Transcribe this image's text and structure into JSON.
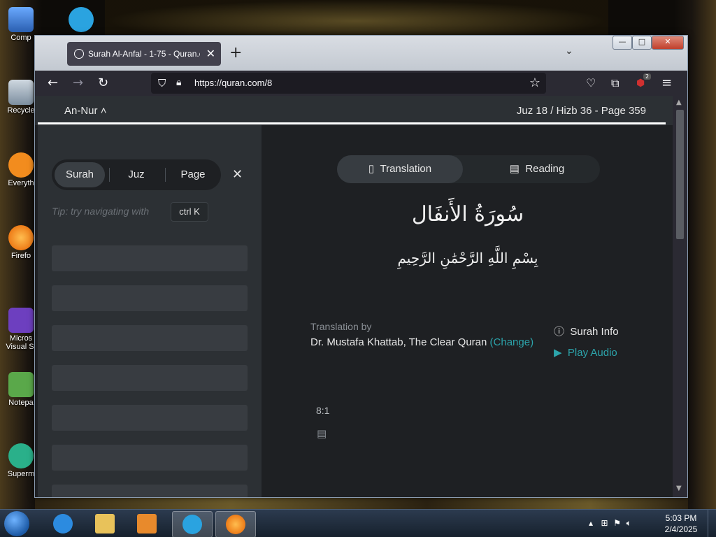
{
  "desktop": {
    "icons": [
      {
        "label": "Comp",
        "color": "#3a7bd5"
      },
      {
        "label": "Recycle",
        "color": "#8fa8c0"
      },
      {
        "label": "Everyth",
        "color": "#f28c1e"
      },
      {
        "label": "Firefo",
        "color": "#e66000"
      },
      {
        "label": "Micros\nVisual St",
        "color": "#6d3fbf"
      },
      {
        "label": "Notepa",
        "color": "#5aa84a"
      },
      {
        "label": "Superm",
        "color": "#2ab08a"
      }
    ]
  },
  "browser": {
    "tab_title": "Surah Al-Anfal - 1-75 - Quran.c",
    "url": "https://quran.com/8",
    "extension_badge": "2"
  },
  "page": {
    "chapter_nav": "An-Nur",
    "location": "Juz 18 / Hizb 36 - Page 359",
    "sidebar": {
      "tabs": [
        "Surah",
        "Juz",
        "Page"
      ],
      "tip": "Tip: try navigating with",
      "shortcut": "ctrl  K"
    },
    "modes": {
      "translation": "Translation",
      "reading": "Reading"
    },
    "surah_name_arabic": "سُورَةُ الأَنفَال",
    "bismillah": "بِسْمِ اللَّهِ الرَّحْمَٰنِ الرَّحِيمِ",
    "translation_by_label": "Translation by",
    "translator": "Dr. Mustafa Khattab, The Clear Quran",
    "change_label": "(Change)",
    "surah_info": "Surah Info",
    "play_audio": "Play Audio",
    "verse_key": "8:1"
  },
  "taskbar": {
    "time": "5:03 PM",
    "date": "2/4/2025"
  },
  "colors": {
    "accent": "#2ca4ab",
    "page_bg": "#1e2023",
    "sidebar_bg": "#2c3034"
  }
}
